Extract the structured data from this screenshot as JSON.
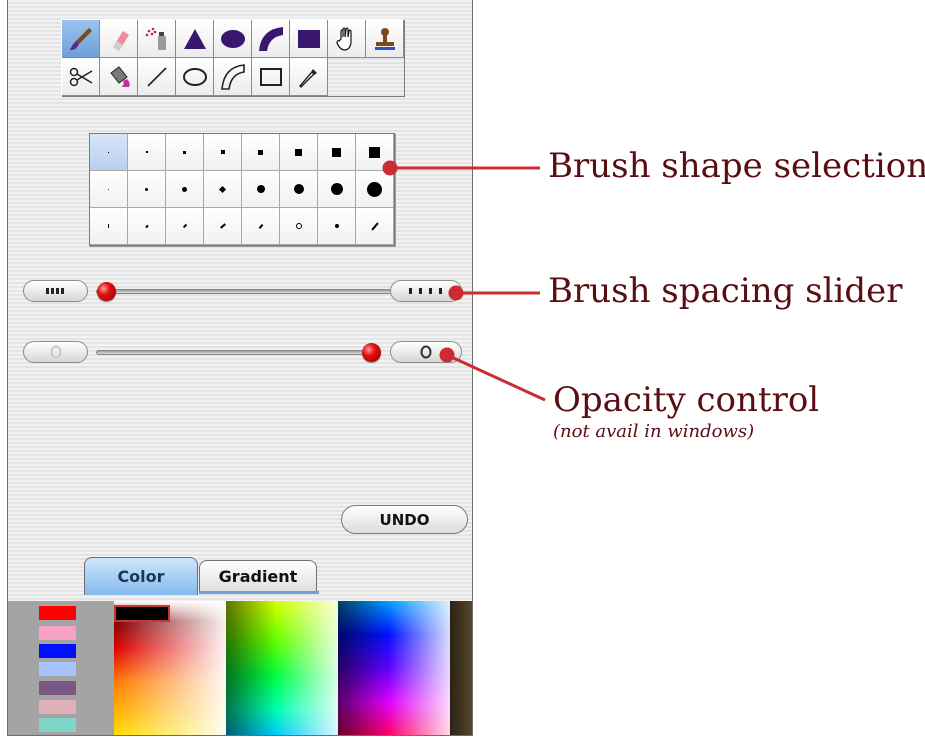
{
  "tool_palette": {
    "row1": [
      "paintbrush-icon",
      "eraser-icon",
      "spray-can-icon",
      "filled-triangle-icon",
      "filled-ellipse-icon",
      "filled-arc-icon",
      "filled-rectangle-icon",
      "hand-icon"
    ],
    "row2": [
      "stamp-icon",
      "scissors-icon",
      "paint-bucket-icon",
      "line-icon",
      "ellipse-outline-icon",
      "arc-outline-icon",
      "rectangle-outline-icon",
      "eyedropper-icon"
    ],
    "selected": "paintbrush-icon"
  },
  "sliders": {
    "spacing": {
      "value": 0.0
    },
    "opacity": {
      "value": 1.0
    }
  },
  "buttons": {
    "undo_label": "UNDO"
  },
  "tabs": [
    {
      "label": "Color",
      "active": true
    },
    {
      "label": "Gradient",
      "active": false
    }
  ],
  "swatches": [
    "#ff0000",
    "#f7a1c4",
    "#0010ff",
    "#a7c4ff",
    "#7a5a84",
    "#e0b0b8",
    "#7fd6c8"
  ],
  "annotations": {
    "brush_shape": "Brush shape selection",
    "brush_spacing": "Brush spacing slider",
    "opacity": "Opacity control",
    "opacity_note": "(not avail in windows)"
  },
  "colors": {
    "callout": "#5a0d12",
    "callout_line": "#cc2b33",
    "knob": "#e21010",
    "tab_active": "#84b9ec"
  }
}
